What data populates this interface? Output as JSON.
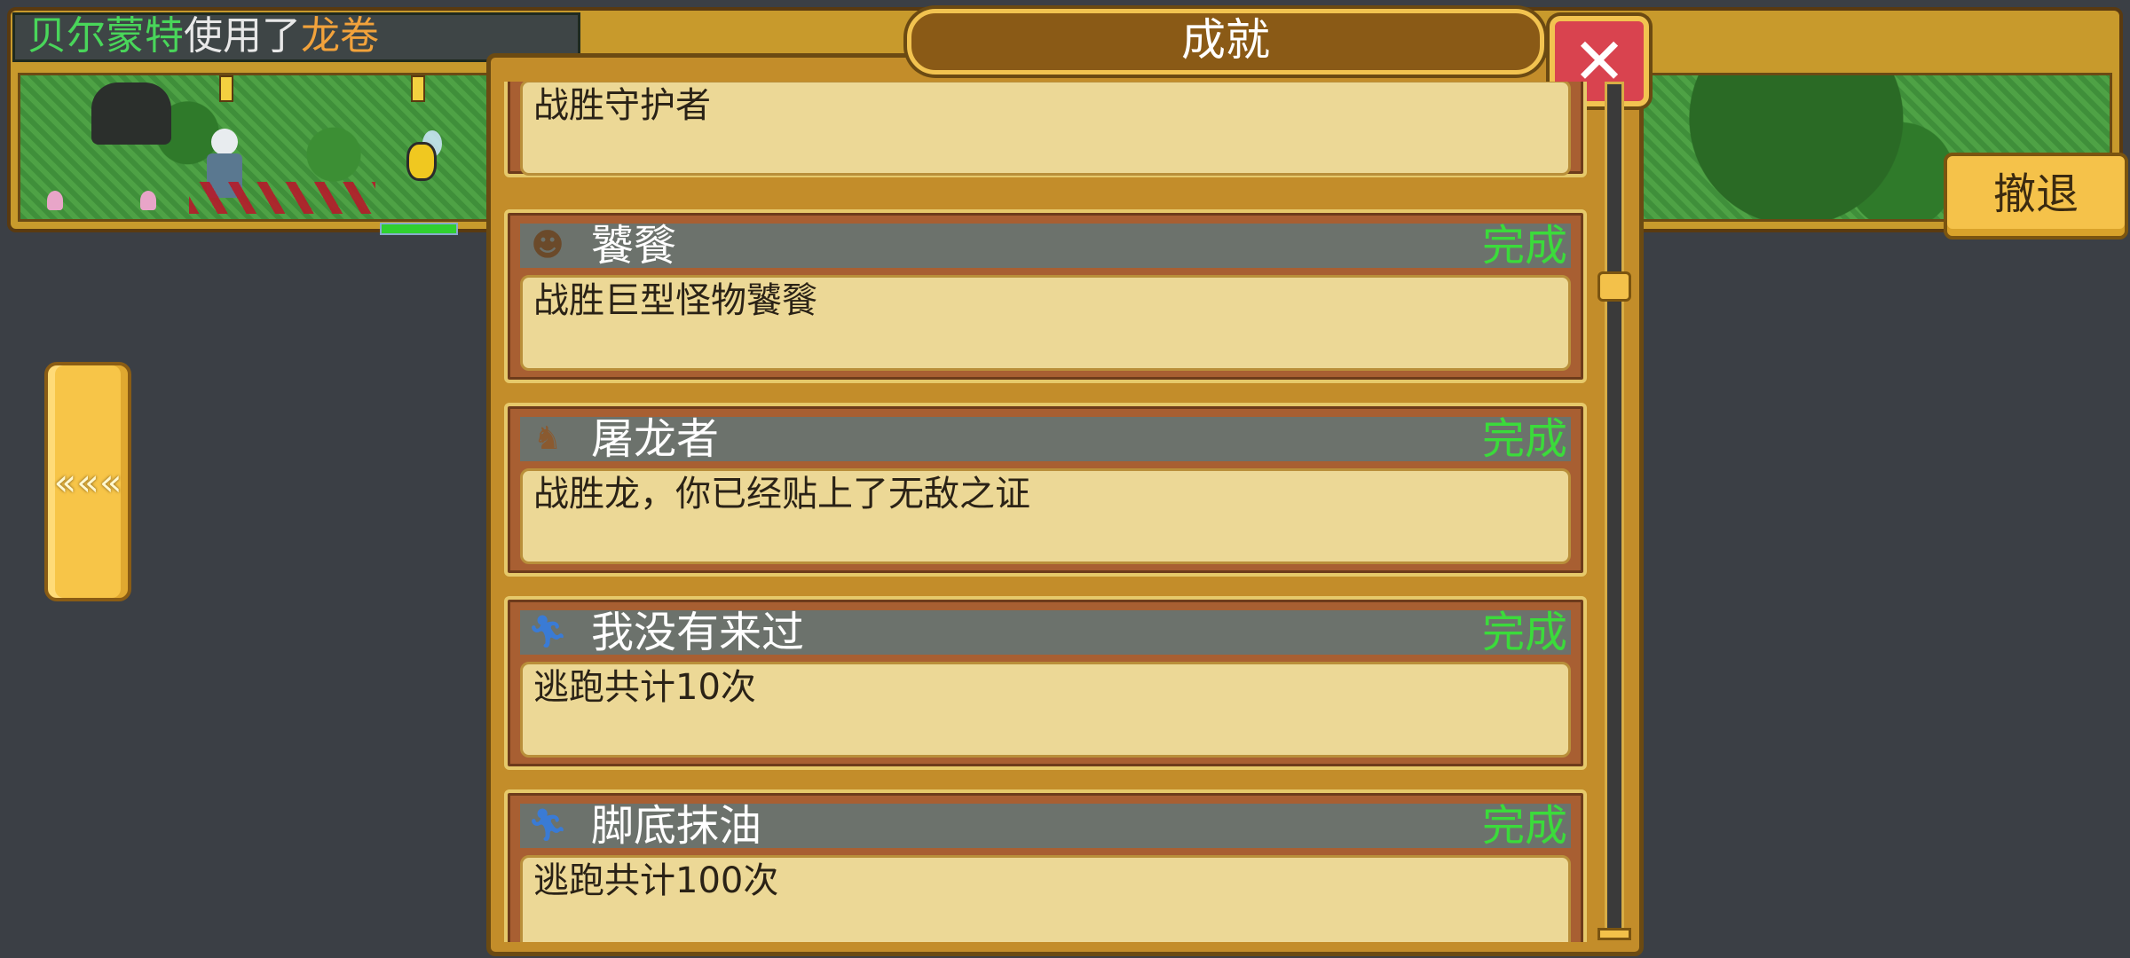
{
  "battle_log": {
    "actor": "贝尔蒙特",
    "verb": "使用了",
    "skill": "龙卷"
  },
  "battle": {
    "enemy_hp_fraction": 1.0
  },
  "retreat_button": {
    "label": "撤退"
  },
  "back_button": {
    "label": "«««",
    "icon": "triple-chevron-left-icon"
  },
  "panel": {
    "title": "成就",
    "close_label": "✕"
  },
  "achievements": [
    {
      "name": "",
      "status": "",
      "description": "战胜守护者",
      "icon": ""
    },
    {
      "name": "饕餮",
      "status": "完成",
      "description": "战胜巨型怪物饕餮",
      "icon": "ogre-icon"
    },
    {
      "name": "屠龙者",
      "status": "完成",
      "description": "战胜龙，你已经贴上了无敌之证",
      "icon": "dragon-icon"
    },
    {
      "name": "我没有来过",
      "status": "完成",
      "description": "逃跑共计10次",
      "icon": "running-person-icon"
    },
    {
      "name": "脚底抹油",
      "status": "完成",
      "description": "逃跑共计100次",
      "icon": "running-person-icon"
    }
  ],
  "colors": {
    "status_complete": "#3bdb3b",
    "actor_name": "#49d65a",
    "skill_name": "#f2a23b"
  }
}
